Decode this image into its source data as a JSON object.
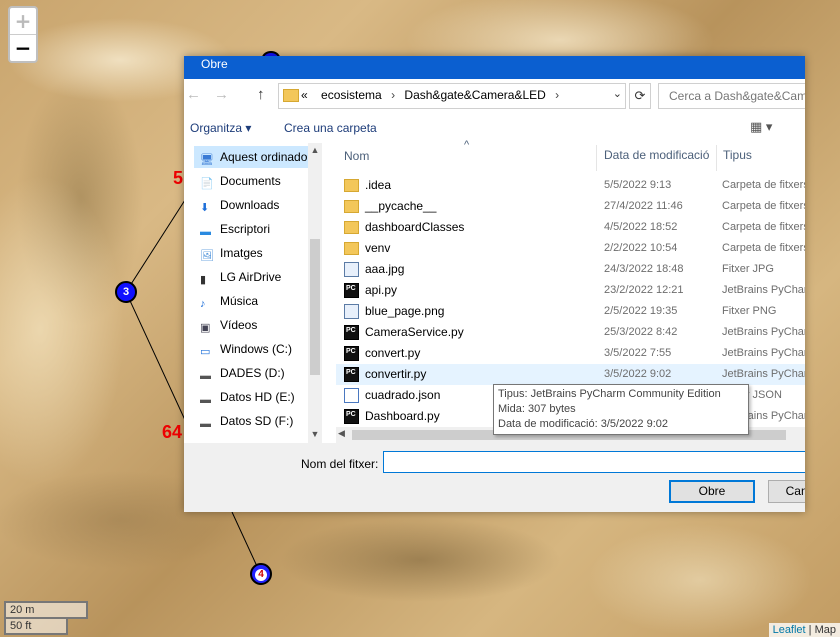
{
  "map": {
    "zoom_in": "+",
    "zoom_out": "−",
    "markers": [
      {
        "label": "3"
      },
      {
        "label": "4"
      }
    ],
    "distance_labels": [
      "5",
      "64"
    ],
    "scale": {
      "metric": "20 m",
      "imperial": "50 ft"
    },
    "attribution": {
      "link": "Leaflet",
      "sep": " | ",
      "rest": "Map"
    }
  },
  "dialog": {
    "title": "Obre",
    "nav": {
      "back": "←",
      "forward": "→",
      "up": "↑"
    },
    "address": {
      "prefix": "«",
      "crumbs": [
        "ecosistema",
        "Dash&gate&Camera&LED"
      ],
      "separator": "›"
    },
    "search_placeholder": "Cerca a Dash&gate&Camera&LED",
    "toolbar": {
      "organize": "Organitza ▾",
      "new_folder": "Crea una carpeta",
      "views": "▦ ▾"
    },
    "nav_items": [
      {
        "label": "Aquest ordinador",
        "icon": "computer-icon",
        "selected": true
      },
      {
        "label": "Documents",
        "icon": "documents-icon"
      },
      {
        "label": "Downloads",
        "icon": "download-icon"
      },
      {
        "label": "Escriptori",
        "icon": "desktop-icon"
      },
      {
        "label": "Imatges",
        "icon": "pictures-icon"
      },
      {
        "label": "LG AirDrive",
        "icon": "drive-icon"
      },
      {
        "label": "Música",
        "icon": "music-icon"
      },
      {
        "label": "Vídeos",
        "icon": "videos-icon"
      },
      {
        "label": "Windows (C:)",
        "icon": "windows-drive-icon"
      },
      {
        "label": "DADES (D:)",
        "icon": "disk-icon"
      },
      {
        "label": "Datos HD (E:)",
        "icon": "disk-icon"
      },
      {
        "label": "Datos SD (F:)",
        "icon": "disk-icon"
      }
    ],
    "columns": {
      "name": "Nom",
      "date": "Data de modificació",
      "type": "Tipus"
    },
    "files": [
      {
        "name": ".idea",
        "date": "5/5/2022 9:13",
        "type": "Carpeta de fitxers",
        "kind": "folder"
      },
      {
        "name": "__pycache__",
        "date": "27/4/2022 11:46",
        "type": "Carpeta de fitxers",
        "kind": "folder"
      },
      {
        "name": "dashboardClasses",
        "date": "4/5/2022 18:52",
        "type": "Carpeta de fitxers",
        "kind": "folder"
      },
      {
        "name": "venv",
        "date": "2/2/2022 10:54",
        "type": "Carpeta de fitxers",
        "kind": "folder"
      },
      {
        "name": "aaa.jpg",
        "date": "24/3/2022 18:48",
        "type": "Fitxer JPG",
        "kind": "img"
      },
      {
        "name": "api.py",
        "date": "23/2/2022 12:21",
        "type": "JetBrains PyCharm",
        "kind": "py"
      },
      {
        "name": "blue_page.png",
        "date": "2/5/2022 19:35",
        "type": "Fitxer PNG",
        "kind": "img"
      },
      {
        "name": "CameraService.py",
        "date": "25/3/2022 8:42",
        "type": "JetBrains PyCharm",
        "kind": "py"
      },
      {
        "name": "convert.py",
        "date": "3/5/2022 7:55",
        "type": "JetBrains PyCharm",
        "kind": "py"
      },
      {
        "name": "convertir.py",
        "date": "3/5/2022 9:02",
        "type": "JetBrains PyCharm",
        "kind": "py",
        "hover": true
      },
      {
        "name": "cuadrado.json",
        "date": "",
        "type": "Fitxer JSON",
        "kind": "json"
      },
      {
        "name": "Dashboard.py",
        "date": "",
        "type": "JetBrains PyCharm",
        "kind": "py"
      }
    ],
    "tooltip": {
      "type": "Tipus: JetBrains PyCharm Community Edition",
      "size": "Mida: 307 bytes",
      "modified": "Data de modificació: 3/5/2022 9:02"
    },
    "filename_label": "Nom del fitxer:",
    "filename_value": "",
    "open_button": "Obre",
    "cancel_button": "Cancel·la"
  }
}
